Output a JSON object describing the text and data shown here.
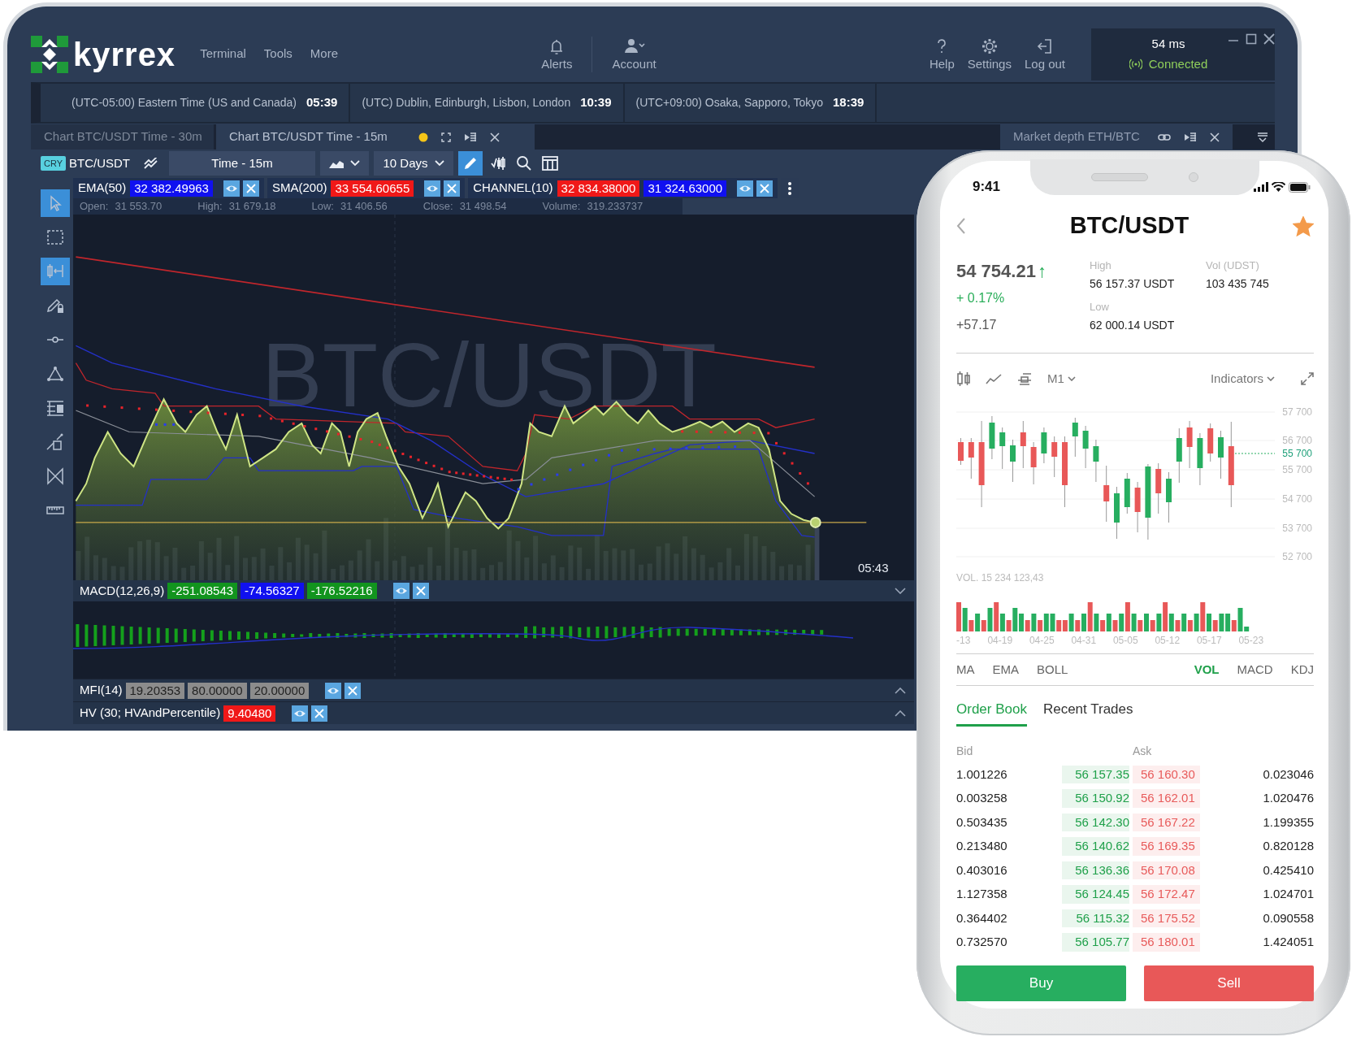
{
  "desktop": {
    "logo": "kyrrex",
    "menu": [
      {
        "label": "Terminal"
      },
      {
        "label": "Tools"
      },
      {
        "label": "More"
      }
    ],
    "actions": [
      {
        "label": "Alerts"
      },
      {
        "label": "Account"
      },
      {
        "label": "Help"
      },
      {
        "label": "Settings"
      },
      {
        "label": "Log out"
      }
    ],
    "connection": {
      "latency": "54 ms",
      "status": "Connected"
    },
    "clocks": [
      {
        "zone": "(UTC-05:00) Eastern Time (US and Canada)",
        "time": "05:39"
      },
      {
        "zone": "(UTC) Dublin, Edinburgh, Lisbon, London",
        "time": "10:39"
      },
      {
        "zone": "(UTC+09:00) Osaka, Sapporo, Tokyo",
        "time": "18:39"
      }
    ],
    "tabs": [
      {
        "label": "Chart BTC/USDT Time - 30m",
        "selected": false,
        "modified": false
      },
      {
        "label": "Chart BTC/USDT Time - 15m",
        "selected": true,
        "modified": true
      }
    ],
    "side_tab": {
      "label": "Market depth ETH/BTC"
    },
    "toolbar": {
      "market_tag": "CRY",
      "symbol": "BTC/USDT",
      "interval": "Time - 15m",
      "range": "10 Days",
      "drawing_active": true
    },
    "tools": [
      {
        "selected": true
      },
      {
        "selected": false
      },
      {
        "selected": true
      },
      {
        "selected": false
      },
      {
        "selected": false
      },
      {
        "selected": false
      },
      {
        "selected": false
      },
      {
        "selected": false
      },
      {
        "selected": false
      },
      {
        "selected": false
      }
    ],
    "indicators": [
      {
        "name": "EMA(50)",
        "values": [
          {
            "text": "32 382.49963",
            "color": "#1010f0"
          }
        ]
      },
      {
        "name": "SMA(200)",
        "values": [
          {
            "text": "33 554.60655",
            "color": "#f01818"
          }
        ]
      },
      {
        "name": "CHANNEL(10)",
        "values": [
          {
            "text": "32 834.38000",
            "color": "#f01818"
          },
          {
            "text": "31 324.63000",
            "color": "#1010f0"
          }
        ]
      }
    ],
    "ohlc": [
      {
        "label": "Open:",
        "value": "31 553.70"
      },
      {
        "label": "High:",
        "value": "31 679.18"
      },
      {
        "label": "Low:",
        "value": "31 406.56"
      },
      {
        "label": "Close:",
        "value": "31 498.54"
      },
      {
        "label": "Volume:",
        "value": "319.233737"
      }
    ],
    "chart": {
      "watermark": "BTC/USDT",
      "time": "05:43"
    },
    "panes": [
      {
        "name": "MACD(12,26,9)",
        "expanded": true,
        "values": [
          {
            "text": "-251.08543",
            "color": "#12941e"
          },
          {
            "text": "-74.56327",
            "color": "#1010f0"
          },
          {
            "text": "-176.52216",
            "color": "#12941e"
          }
        ]
      },
      {
        "name": "MFI(14)",
        "expanded": false,
        "values": [
          {
            "text": "19.20353",
            "color": "#8c8c8c"
          },
          {
            "text": "80.00000",
            "color": "#8c8c8c"
          },
          {
            "text": "20.00000",
            "color": "#8c8c8c"
          }
        ]
      },
      {
        "name": "HV (30; HVAndPercentile)",
        "expanded": false,
        "values": [
          {
            "text": "9.40480",
            "color": "#f01818"
          }
        ]
      }
    ]
  },
  "phone": {
    "status_time": "9:41",
    "title": "BTC/USDT",
    "favorite": true,
    "price": "54 754.21",
    "price_arrow": "↑",
    "change_pct": "+ 0.17%",
    "change_abs": "+57.17",
    "stats": [
      {
        "label": "High",
        "value": "56 157.37 USDT"
      },
      {
        "label": "Vol (UDST)",
        "value": "103 435 745"
      },
      {
        "label": "Low",
        "value": "62 000.14 USDT"
      }
    ],
    "timeframe": "M1",
    "indicators_menu": "Indicators",
    "y_labels": [
      "57 700",
      "56 700",
      "55 700",
      "54 700",
      "53 700",
      "52 700"
    ],
    "current_price": "55 700",
    "volume_label": "VOL. 15 234 123,43",
    "x_labels": [
      "-13",
      "04-19",
      "04-25",
      "04-31",
      "05-05",
      "05-12",
      "05-17",
      "05-23"
    ],
    "indicator_tabs": [
      {
        "label": "MA",
        "selected": false
      },
      {
        "label": "EMA",
        "selected": false
      },
      {
        "label": "BOLL",
        "selected": false
      },
      {
        "label": "VOL",
        "selected": true
      },
      {
        "label": "MACD",
        "selected": false
      },
      {
        "label": "KDJ",
        "selected": false
      }
    ],
    "book_tabs": [
      {
        "label": "Order Book",
        "selected": true
      },
      {
        "label": "Recent Trades",
        "selected": false
      }
    ],
    "book_headers": [
      "Bid",
      "Ask"
    ],
    "book": [
      {
        "bid_qty": "1.001226",
        "bid": "56 157.35",
        "ask": "56 160.30",
        "ask_qty": "0.023046"
      },
      {
        "bid_qty": "0.003258",
        "bid": "56 150.92",
        "ask": "56 162.01",
        "ask_qty": "1.020476"
      },
      {
        "bid_qty": "0.503435",
        "bid": "56 142.30",
        "ask": "56 167.22",
        "ask_qty": "1.199355"
      },
      {
        "bid_qty": "0.213480",
        "bid": "56 140.62",
        "ask": "56 169.35",
        "ask_qty": "0.820128"
      },
      {
        "bid_qty": "0.403016",
        "bid": "56 136.36",
        "ask": "56 170.08",
        "ask_qty": "0.425410"
      },
      {
        "bid_qty": "1.127358",
        "bid": "56 124.45",
        "ask": "56 172.47",
        "ask_qty": "1.024701"
      },
      {
        "bid_qty": "0.364402",
        "bid": "56 115.32",
        "ask": "56 175.52",
        "ask_qty": "0.090558"
      },
      {
        "bid_qty": "0.732570",
        "bid": "56 105.77",
        "ask": "56 180.01",
        "ask_qty": "1.424051"
      }
    ],
    "buttons": [
      {
        "label": "Buy",
        "kind": "buy"
      },
      {
        "label": "Sell",
        "kind": "sell"
      }
    ]
  }
}
